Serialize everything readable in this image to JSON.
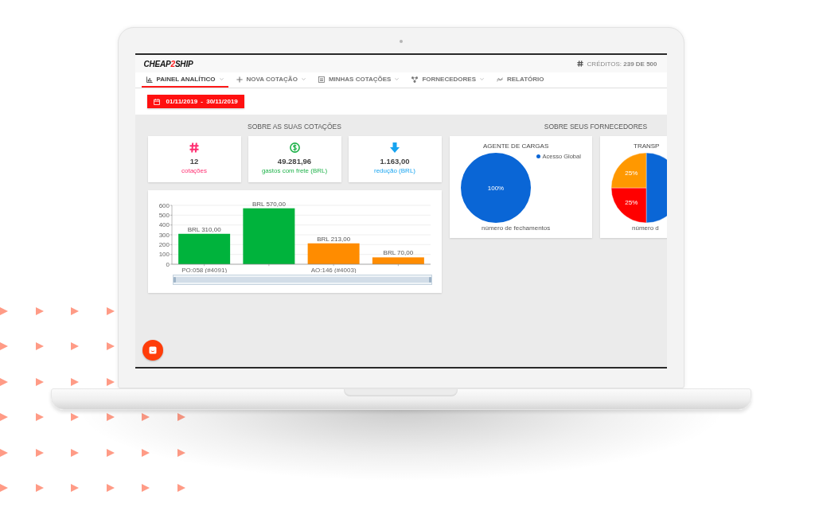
{
  "logo": {
    "parts": [
      {
        "text": "CHEAP",
        "accent": false
      },
      {
        "text": "2",
        "accent": true
      },
      {
        "text": "SHIP",
        "accent": false
      }
    ]
  },
  "credits": {
    "text": "CRÉDITOS: **239 DE 500**"
  },
  "tabs": [
    {
      "label": "PAINEL ANALÍTICO",
      "selected": true,
      "dropdown": true
    },
    {
      "label": "NOVA COTAÇÃO",
      "selected": false,
      "dropdown": true
    },
    {
      "label": "MINHAS COTAÇÕES",
      "selected": false,
      "dropdown": true
    },
    {
      "label": "FORNECEDORES",
      "selected": false,
      "dropdown": true
    },
    {
      "label": "RELATÓRIO",
      "selected": false,
      "dropdown": false
    }
  ],
  "date_filter": {
    "label": "01/11/2019 - 30/11/2019"
  },
  "quotes": {
    "title": "SOBRE AS SUAS COTAÇÕES",
    "stats": [
      {
        "value": "12",
        "label": "cotações",
        "color": "#ff2d70"
      },
      {
        "value": "49.281,96",
        "label": "gastos com frete (BRL)",
        "color": "#1fb24a"
      },
      {
        "value": "1.163,00",
        "label": "redução (BRL)",
        "color": "#17a4f0"
      }
    ],
    "chart_data": {
      "type": "bar",
      "stacked": true,
      "grid": true,
      "categories": [
        "PO:058 (#4091)",
        null,
        "AO:146 (#4003)",
        null
      ],
      "series": [
        {
          "color": "#00b33c",
          "values": [
            310,
            570,
            null,
            null
          ]
        },
        {
          "color": "#ff8c00",
          "values": [
            null,
            null,
            213,
            70
          ]
        }
      ],
      "ylim": [
        0,
        600
      ],
      "yticks": [
        0,
        100,
        200,
        300,
        400,
        500,
        600
      ],
      "value_labels": [
        "BRL 310,00",
        "BRL 570,00",
        "BRL 213,00",
        "BRL 70,00"
      ]
    },
    "zoom_slider": {
      "level": 1
    }
  },
  "suppliers": {
    "title": "SOBRE SEUS FORNECEDORES",
    "charts": [
      {
        "caption": "número de fechamentos",
        "chart_data": {
          "type": "pie",
          "title": "AGENTE DE CARGAS",
          "categories": [
            "Acesso Global"
          ],
          "values": [
            100
          ],
          "colors": [
            "#0a66d6"
          ],
          "value_labels": [
            "100%"
          ]
        }
      },
      {
        "caption": "número d",
        "chart_data": {
          "type": "pie",
          "title": "TRANSP",
          "values": [
            50,
            25,
            25
          ],
          "colors": [
            "#0a66d6",
            "#ff0000",
            "#ff9800"
          ],
          "value_labels": [
            null,
            "25%",
            "25%"
          ]
        }
      }
    ]
  }
}
